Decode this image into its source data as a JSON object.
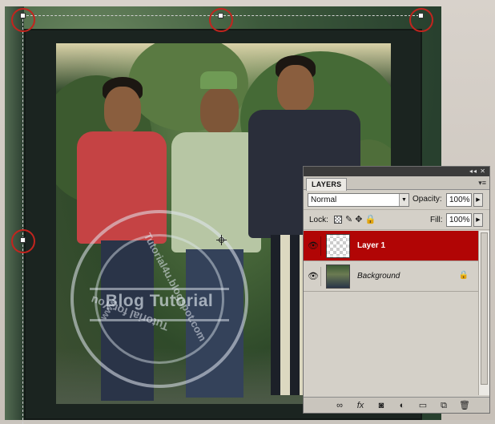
{
  "photo": {
    "watermark": {
      "center_text": "Blog Tutorial",
      "ring_url": "Tutorial4u.blogspot.com",
      "ring_bottom": "Tutorial for You",
      "ring_left": "www"
    }
  },
  "layers_panel": {
    "tab_label": "LAYERS",
    "titlebar_icons": "◂◂ ✕",
    "menu_icon": "▾≡",
    "blend_mode": "Normal",
    "opacity_label": "Opacity:",
    "opacity_value": "100%",
    "lock_label": "Lock:",
    "fill_label": "Fill:",
    "fill_value": "100%",
    "layers": [
      {
        "name": "Layer 1",
        "selected": true,
        "visible": true
      },
      {
        "name": "Background",
        "selected": false,
        "visible": true,
        "locked": true
      }
    ],
    "footer_icons": [
      "link-icon",
      "fx-icon",
      "mask-icon",
      "adjustment-icon",
      "group-icon",
      "new-layer-icon",
      "trash-icon"
    ]
  },
  "colors": {
    "selection_red": "#b10505",
    "annotation_red": "#c3241e",
    "panel_bg": "#d4d0c8"
  }
}
